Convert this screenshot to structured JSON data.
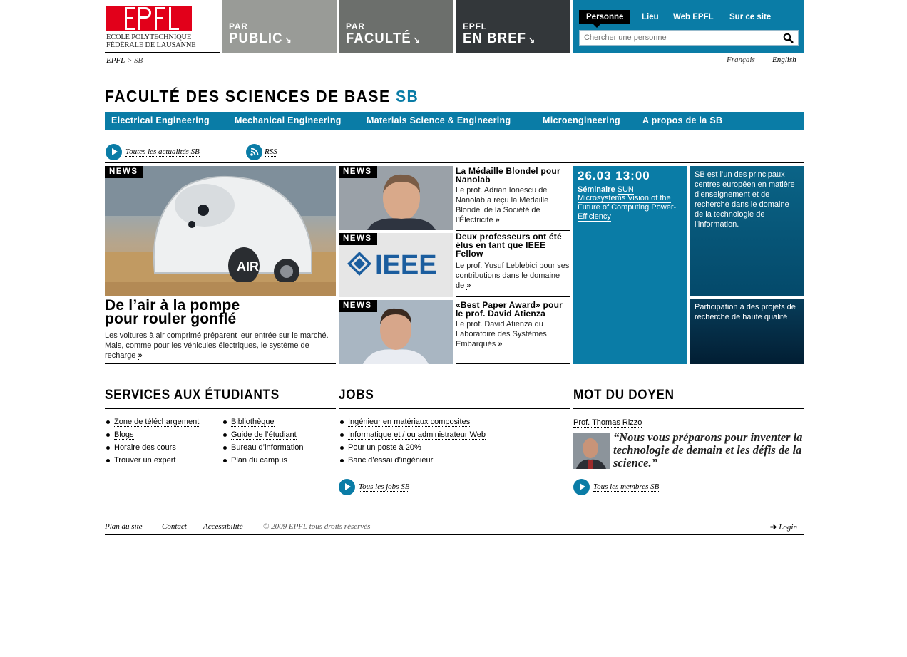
{
  "header": {
    "logo_text_line1": "ÉCOLE POLYTECHNIQUE",
    "logo_text_line2": "FÉDÉRALE DE LAUSANNE",
    "logo_letters": "EPFL",
    "nav": [
      {
        "small": "PAR",
        "big": "PUBLIC",
        "color": "#999b97"
      },
      {
        "small": "PAR",
        "big": "FACULTÉ",
        "color": "#6c6f6c"
      },
      {
        "small": "EPFL",
        "big": "EN BREF",
        "color": "#33373a"
      }
    ],
    "search": {
      "tabs": [
        "Personne",
        "Lieu",
        "Web EPFL",
        "Sur ce site"
      ],
      "active_tab": "Personne",
      "placeholder": "Chercher une personne",
      "accent": "#0a7ca6"
    }
  },
  "breadcrumb": {
    "root": "EPFL",
    "separator": ">",
    "current": "SB"
  },
  "languages": {
    "fr": "Français",
    "en": "English"
  },
  "faculty": {
    "title": "FACULTÉ DES SCIENCES DE BASE",
    "acronym": "SB"
  },
  "subnav": [
    "Electrical Engineering",
    "Mechanical Engineering",
    "Materials Science & Engineering",
    "Microengineering",
    "A propos de la SB"
  ],
  "news_links": {
    "all_news": "Toutes les actualités SB",
    "rss": "RSS"
  },
  "news_tag": "NEWS",
  "feature": {
    "title_line1": "De l’air à la pompe",
    "title_line2": "pour rouler gonflé",
    "text": "Les voitures à air comprimé préparent leur entrée sur le marché. Mais, comme pour les véhicules électriques, le système de recharge",
    "car_label": "AIR"
  },
  "side_news": [
    {
      "title": "La Médaille Blondel pour Nanolab",
      "text": "Le prof. Adrian Ionescu de Nanolab a reçu la Médaille Blondel de la Société de l’Électricité"
    },
    {
      "title": "Deux professeurs ont été élus en tant que IEEE Fellow",
      "text": "Le prof. Yusuf Leblebici pour ses contributions dans le domaine de",
      "logo": "IEEE"
    },
    {
      "title": "«Best Paper Award» pour le prof.  David Atienza",
      "text": "Le prof. David Atienza du Laboratoire des Systèmes Embarqués"
    }
  ],
  "more_marker": "»",
  "event": {
    "datetime": "26.03 13:00",
    "kind": "Séminaire",
    "org": "SUN",
    "title": "Microsystems Vision of the Future of Computing Power-Efficiency"
  },
  "info_boxes": [
    "SB est l’un des principaux centres européen en matière d’enseignement et de recherche dans le domaine de la technologie de l’information.",
    "Participation à des projets de recherche de haute qualité"
  ],
  "services": {
    "title": "SERVICES AUX ÉTUDIANTS",
    "col1": [
      "Zone de téléchargement",
      "Blogs",
      "Horaire des cours",
      "Trouver un expert"
    ],
    "col2": [
      "Bibliothèque",
      "Guide de l’étudiant",
      "Bureau d’information ",
      "Plan du campus"
    ]
  },
  "jobs": {
    "title": "JOBS",
    "items": [
      "Ingénieur en matériaux composites",
      "Informatique et / ou administrateur Web",
      "Pour un poste à 20%",
      "Banc d’essai d’ingénieur"
    ],
    "all_link": "Tous les jobs SB"
  },
  "doyen": {
    "title": "MOT DU DOYEN",
    "name": "Prof. Thomas Rizzo",
    "quote": "“Nous vous préparons pour inventer la technologie de demain et les défis de la science.”",
    "all_link": "Tous les membres SB"
  },
  "footer": {
    "links": [
      "Plan du site",
      "Contact",
      "Accessibilité"
    ],
    "copyright": "© 2009 EPFL tous droits réservés",
    "login": "Login"
  }
}
